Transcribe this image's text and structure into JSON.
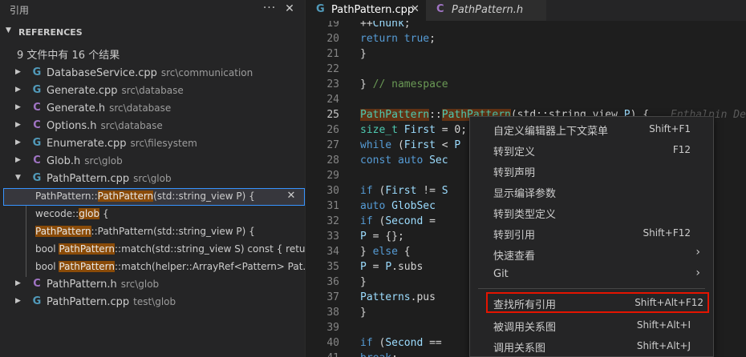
{
  "sidebar": {
    "title": "引用",
    "more_icon": "ellipsis-icon",
    "close_icon": "close-icon",
    "section_title": "REFERENCES",
    "summary": "9 文件中有 16 个结果",
    "files_before": [
      {
        "icon": "C++",
        "name": "DatabaseService.cpp",
        "dir": "src\\communication"
      },
      {
        "icon": "C++",
        "name": "Generate.cpp",
        "dir": "src\\database"
      },
      {
        "icon": "C",
        "name": "Generate.h",
        "dir": "src\\database"
      },
      {
        "icon": "C",
        "name": "Options.h",
        "dir": "src\\database"
      },
      {
        "icon": "C++",
        "name": "Enumerate.cpp",
        "dir": "src\\filesystem"
      },
      {
        "icon": "C",
        "name": "Glob.h",
        "dir": "src\\glob"
      },
      {
        "icon": "C++",
        "name": "PathPattern.cpp",
        "dir": "src\\glob"
      }
    ],
    "references": [
      {
        "pre": "PathPattern::",
        "match": "PathPattern",
        "post": "(std::string_view P) {"
      },
      {
        "pre": "wecode::",
        "match": "glob",
        "post": " {"
      },
      {
        "pre": "",
        "match": "PathPattern",
        "post": "::PathPattern(std::string_view P) {"
      },
      {
        "pre": "bool ",
        "match": "PathPattern",
        "post": "::match(std::string_view S) const { retur..."
      },
      {
        "pre": "bool ",
        "match": "PathPattern",
        "post": "::match(helper::ArrayRef<Pattern> Pat..."
      }
    ],
    "files_after": [
      {
        "icon": "C",
        "name": "PathPattern.h",
        "dir": "src\\glob"
      },
      {
        "icon": "C++",
        "name": "PathPattern.cpp",
        "dir": "test\\glob"
      }
    ]
  },
  "tabs": [
    {
      "icon": "C++",
      "label": "PathPattern.cpp",
      "active": true
    },
    {
      "icon": "C",
      "label": "PathPattern.h",
      "active": false
    }
  ],
  "editor": {
    "lines": [
      {
        "no": "19",
        "code": "    ++Chunk;"
      },
      {
        "no": "20",
        "code": "  return true;"
      },
      {
        "no": "21",
        "code": "}"
      },
      {
        "no": "22",
        "code": ""
      },
      {
        "no": "23",
        "code": "} // namespace"
      },
      {
        "no": "24",
        "code": ""
      },
      {
        "no": "25",
        "code": "PathPattern::PathPattern(std::string_view P) {"
      },
      {
        "no": "26",
        "code": "  size_t First = 0;"
      },
      {
        "no": "27",
        "code": "  while (First < P"
      },
      {
        "no": "28",
        "code": "    const auto Sec"
      },
      {
        "no": "29",
        "code": ""
      },
      {
        "no": "30",
        "code": "    if (First != S"
      },
      {
        "no": "31",
        "code": "      auto GlobSec"
      },
      {
        "no": "32",
        "code": "      if (Second ="
      },
      {
        "no": "33",
        "code": "        P = {};"
      },
      {
        "no": "34",
        "code": "      } else {"
      },
      {
        "no": "35",
        "code": "        P = P.subs"
      },
      {
        "no": "36",
        "code": "      }"
      },
      {
        "no": "37",
        "code": "      Patterns.pus"
      },
      {
        "no": "38",
        "code": "    }"
      },
      {
        "no": "39",
        "code": ""
      },
      {
        "no": "40",
        "code": "    if (Second =="
      },
      {
        "no": "41",
        "code": "      break;"
      }
    ],
    "ghost_hint": "Enthalpin Den"
  },
  "context_menu": {
    "items": [
      {
        "label": "自定义编辑器上下文菜单",
        "key": "Shift+F1"
      },
      {
        "label": "转到定义",
        "key": "F12"
      },
      {
        "label": "转到声明",
        "key": ""
      },
      {
        "label": "显示编译参数",
        "key": ""
      },
      {
        "label": "转到类型定义",
        "key": ""
      },
      {
        "label": "转到引用",
        "key": "Shift+F12"
      },
      {
        "label": "快速查看",
        "key": "",
        "submenu": true
      },
      {
        "label": "Git",
        "key": "",
        "submenu": true
      },
      {
        "label": "查找所有引用",
        "key": "Shift+Alt+F12",
        "highlighted": true
      },
      {
        "label": "被调用关系图",
        "key": "Shift+Alt+I"
      },
      {
        "label": "调用关系图",
        "key": "Shift+Alt+J"
      }
    ],
    "submenu_arrow": "›"
  },
  "colors": {
    "highlight": "#8a4b08",
    "selection_border": "#3794ff",
    "menu_highlight_border": "#e51400",
    "cpp_icon": "#519aba",
    "h_icon": "#a074c4"
  }
}
